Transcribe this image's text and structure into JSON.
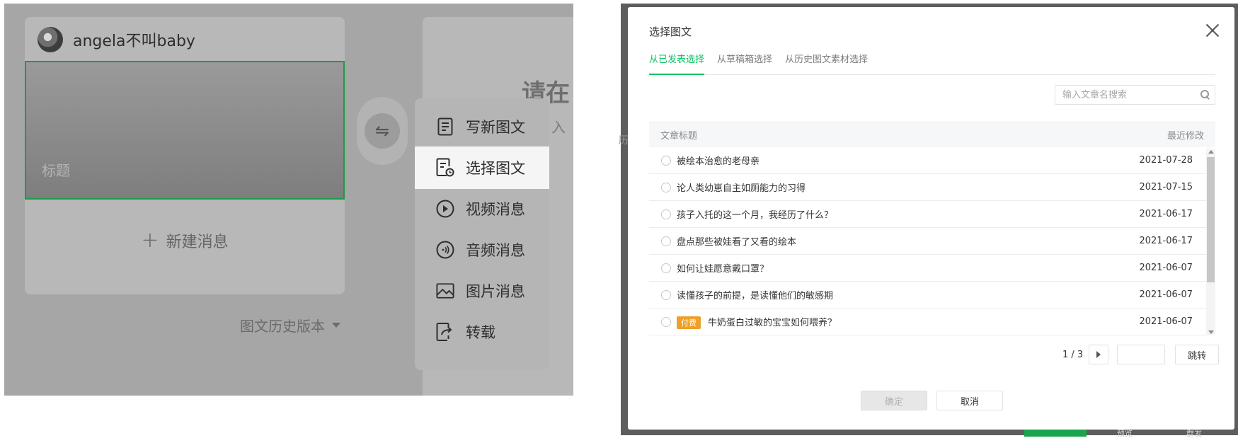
{
  "left": {
    "account_name": "angela不叫baby",
    "cover_title_placeholder": "标题",
    "new_message_label": "新建消息",
    "history_version_label": "图文历史版本",
    "right_prompt": "请在",
    "right_prompt_sub": "入",
    "side_text": "历",
    "menu": [
      {
        "label": "写新图文",
        "icon": "document-icon"
      },
      {
        "label": "选择图文",
        "icon": "document-clock-icon"
      },
      {
        "label": "视频消息",
        "icon": "play-icon"
      },
      {
        "label": "音频消息",
        "icon": "audio-icon"
      },
      {
        "label": "图片消息",
        "icon": "image-icon"
      },
      {
        "label": "转载",
        "icon": "share-icon"
      }
    ]
  },
  "dialog": {
    "title": "选择图文",
    "tabs": [
      "从已发表选择",
      "从草稿箱选择",
      "从历史图文素材选择"
    ],
    "active_tab": "从已发表选择",
    "search_placeholder": "输入文章名搜索",
    "table": {
      "col_title": "文章标题",
      "col_date": "最近修改",
      "rows": [
        {
          "title": "被绘本治愈的老母亲",
          "date": "2021-07-28",
          "paid": ""
        },
        {
          "title": "论人类幼崽自主如厕能力的习得",
          "date": "2021-07-15",
          "paid": ""
        },
        {
          "title": "孩子入托的这一个月，我经历了什么？",
          "date": "2021-06-17",
          "paid": ""
        },
        {
          "title": "盘点那些被娃看了又看的绘本",
          "date": "2021-06-17",
          "paid": ""
        },
        {
          "title": "如何让娃愿意戴口罩？",
          "date": "2021-06-07",
          "paid": ""
        },
        {
          "title": "读懂孩子的前提，是读懂他们的敏感期",
          "date": "2021-06-07",
          "paid": ""
        },
        {
          "title": "牛奶蛋白过敏的宝宝如何喂养？",
          "date": "2021-06-07",
          "paid": "付费"
        }
      ]
    },
    "pager_text": "1 / 3",
    "jump_label": "跳转",
    "confirm_label": "确定",
    "cancel_label": "取消"
  },
  "below": {
    "text_1": "预览",
    "text_2": "群发"
  },
  "colors": {
    "accent": "#07c160",
    "cover_border": "#1e9a4a",
    "paid_badge": "#eea02a"
  }
}
